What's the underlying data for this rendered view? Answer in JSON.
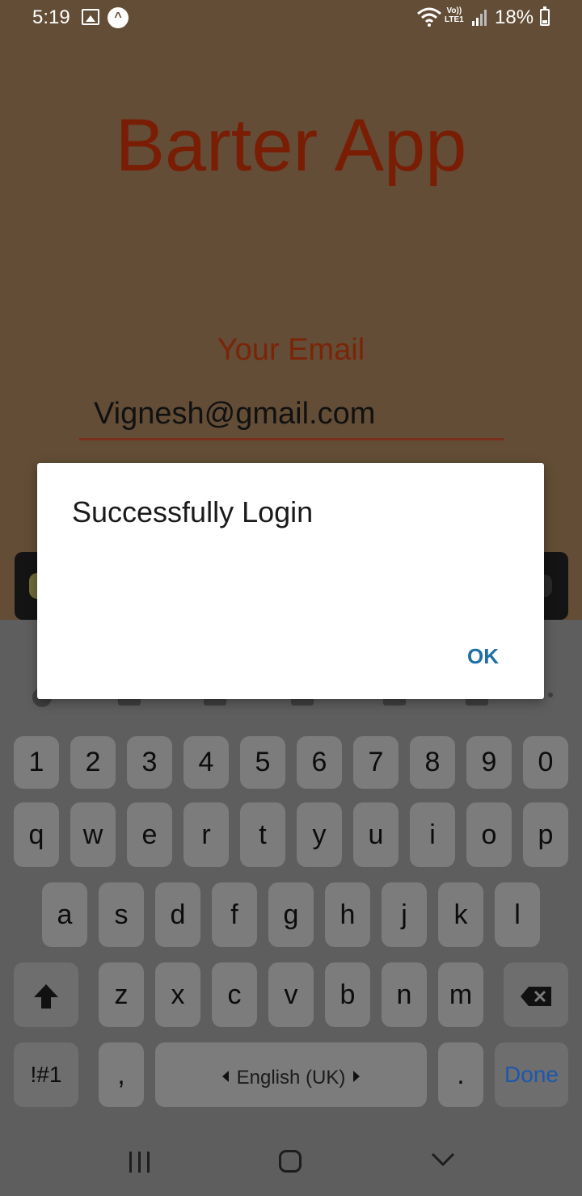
{
  "status_bar": {
    "time": "5:19",
    "volte_line1": "Vo))",
    "volte_line2": "LTE1",
    "battery": "18%"
  },
  "app": {
    "title": "Barter App",
    "email_label": "Your Email",
    "email_value": "Vignesh@gmail.com",
    "accent_color": "#7a1d05"
  },
  "dialog": {
    "message": "Successfully Login",
    "ok_label": "OK"
  },
  "keyboard": {
    "number_row": [
      "1",
      "2",
      "3",
      "4",
      "5",
      "6",
      "7",
      "8",
      "9",
      "0"
    ],
    "row1": [
      "q",
      "w",
      "e",
      "r",
      "t",
      "y",
      "u",
      "i",
      "o",
      "p"
    ],
    "row2": [
      "a",
      "s",
      "d",
      "f",
      "g",
      "h",
      "j",
      "k",
      "l"
    ],
    "row3": [
      "z",
      "x",
      "c",
      "v",
      "b",
      "n",
      "m"
    ],
    "symbols_label": "!#1",
    "comma_label": ",",
    "space_label": "English (UK)",
    "period_label": ".",
    "done_label": "Done"
  }
}
